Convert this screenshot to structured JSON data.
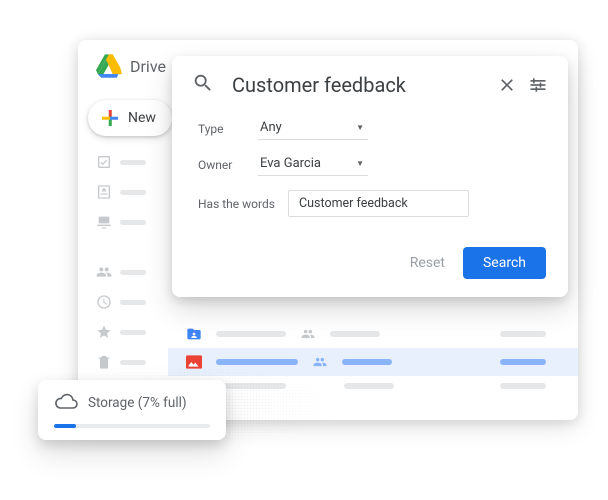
{
  "app": {
    "title": "Drive",
    "new_label": "New"
  },
  "search": {
    "query": "Customer feedback",
    "filters": {
      "type_label": "Type",
      "type_value": "Any",
      "owner_label": "Owner",
      "owner_value": "Eva Garcia",
      "words_label": "Has the words",
      "words_value": "Customer feedback"
    },
    "reset_label": "Reset",
    "search_label": "Search"
  },
  "storage": {
    "label": "Storage (7% full)",
    "percent": 7
  },
  "colors": {
    "blue": "#1a73e8",
    "grey_text": "#5f6368",
    "skeleton": "#e5e7e9",
    "sel_bg": "#e8f0fe",
    "sel_blue": "#8ab4f8",
    "red_file": "#ea4335",
    "blue_file": "#4285f4"
  }
}
